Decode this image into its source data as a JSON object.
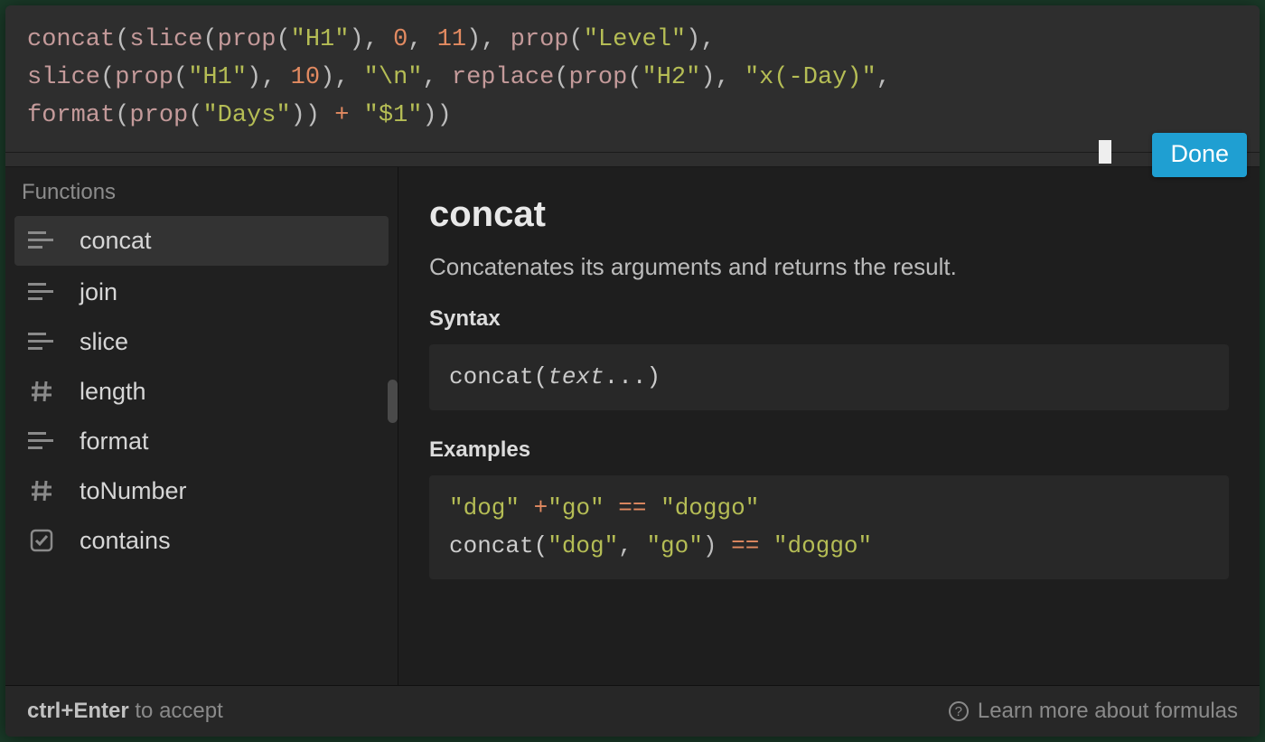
{
  "formula": {
    "tokens": [
      {
        "t": "fn",
        "v": "concat"
      },
      {
        "t": "punc",
        "v": "("
      },
      {
        "t": "fn",
        "v": "slice"
      },
      {
        "t": "punc",
        "v": "("
      },
      {
        "t": "fn",
        "v": "prop"
      },
      {
        "t": "punc",
        "v": "("
      },
      {
        "t": "str",
        "v": "\"H1\""
      },
      {
        "t": "punc",
        "v": "), "
      },
      {
        "t": "num",
        "v": "0"
      },
      {
        "t": "punc",
        "v": ", "
      },
      {
        "t": "num",
        "v": "11"
      },
      {
        "t": "punc",
        "v": "), "
      },
      {
        "t": "fn",
        "v": "prop"
      },
      {
        "t": "punc",
        "v": "("
      },
      {
        "t": "str",
        "v": "\"Level\""
      },
      {
        "t": "punc",
        "v": "), "
      },
      {
        "t": "br"
      },
      {
        "t": "fn",
        "v": "slice"
      },
      {
        "t": "punc",
        "v": "("
      },
      {
        "t": "fn",
        "v": "prop"
      },
      {
        "t": "punc",
        "v": "("
      },
      {
        "t": "str",
        "v": "\"H1\""
      },
      {
        "t": "punc",
        "v": "), "
      },
      {
        "t": "num",
        "v": "10"
      },
      {
        "t": "punc",
        "v": "), "
      },
      {
        "t": "str",
        "v": "\"\\n\""
      },
      {
        "t": "punc",
        "v": ", "
      },
      {
        "t": "fn",
        "v": "replace"
      },
      {
        "t": "punc",
        "v": "("
      },
      {
        "t": "fn",
        "v": "prop"
      },
      {
        "t": "punc",
        "v": "("
      },
      {
        "t": "str",
        "v": "\"H2\""
      },
      {
        "t": "punc",
        "v": "), "
      },
      {
        "t": "str",
        "v": "\"x(-Day)\""
      },
      {
        "t": "punc",
        "v": ", "
      },
      {
        "t": "br"
      },
      {
        "t": "fn",
        "v": "format"
      },
      {
        "t": "punc",
        "v": "("
      },
      {
        "t": "fn",
        "v": "prop"
      },
      {
        "t": "punc",
        "v": "("
      },
      {
        "t": "str",
        "v": "\"Days\""
      },
      {
        "t": "punc",
        "v": ")) "
      },
      {
        "t": "op",
        "v": "+"
      },
      {
        "t": "punc",
        "v": " "
      },
      {
        "t": "str",
        "v": "\"$1\""
      },
      {
        "t": "punc",
        "v": "))"
      }
    ]
  },
  "done_label": "Done",
  "sidebar": {
    "header": "Functions",
    "items": [
      {
        "icon": "text",
        "label": "concat",
        "active": true
      },
      {
        "icon": "text",
        "label": "join"
      },
      {
        "icon": "text",
        "label": "slice"
      },
      {
        "icon": "hash",
        "label": "length"
      },
      {
        "icon": "text",
        "label": "format"
      },
      {
        "icon": "hash",
        "label": "toNumber"
      },
      {
        "icon": "check",
        "label": "contains"
      }
    ]
  },
  "detail": {
    "title": "concat",
    "description": "Concatenates its arguments and returns the result.",
    "syntax_label": "Syntax",
    "syntax_tokens": [
      {
        "t": "plain",
        "v": "concat("
      },
      {
        "t": "italic",
        "v": "text"
      },
      {
        "t": "plain",
        "v": "...)"
      }
    ],
    "examples_label": "Examples",
    "example_lines": [
      [
        {
          "t": "str",
          "v": "\"dog\""
        },
        {
          "t": "punc",
          "v": " "
        },
        {
          "t": "op",
          "v": "+"
        },
        {
          "t": "str",
          "v": "\"go\""
        },
        {
          "t": "punc",
          "v": " "
        },
        {
          "t": "op",
          "v": "=="
        },
        {
          "t": "punc",
          "v": " "
        },
        {
          "t": "str",
          "v": "\"doggo\""
        }
      ],
      [
        {
          "t": "plain",
          "v": "concat("
        },
        {
          "t": "str",
          "v": "\"dog\""
        },
        {
          "t": "punc",
          "v": ", "
        },
        {
          "t": "str",
          "v": "\"go\""
        },
        {
          "t": "punc",
          "v": ") "
        },
        {
          "t": "op",
          "v": "=="
        },
        {
          "t": "punc",
          "v": " "
        },
        {
          "t": "str",
          "v": "\"doggo\""
        }
      ]
    ]
  },
  "footer": {
    "hint_prefix": "ctrl+Enter",
    "hint_rest": " to accept",
    "learn_more": "Learn more about formulas"
  }
}
